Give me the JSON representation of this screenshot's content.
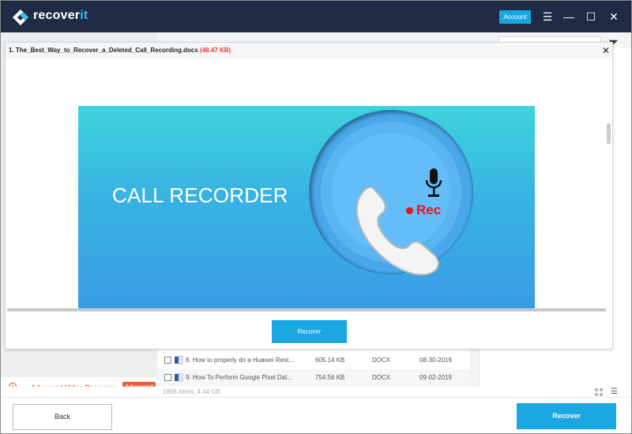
{
  "app": {
    "brand_prefix": "recover",
    "brand_suffix": "it",
    "account_label": "Account",
    "window_controls": [
      "menu-icon",
      "minimize-icon",
      "maximize-icon",
      "close-icon"
    ]
  },
  "modal": {
    "title": "1. The_Best_Way_to_Recover_a_Deleted_Call_Recording.docx",
    "size": "(48.47 KB)",
    "close_glyph": "✕",
    "preview": {
      "banner_text": "CALL RECORDER",
      "rec_text": "Rec"
    },
    "recover_label": "Recover"
  },
  "file_list": {
    "rows": [
      {
        "name": "8. How to properly do a Huawei Rest...",
        "size": "605.14  KB",
        "type": "DOCX",
        "date": "08-30-2019"
      },
      {
        "name": "9. How To Perform Google Pixel Dat...",
        "size": "754.56  KB",
        "type": "DOCX",
        "date": "09-02-2019"
      }
    ],
    "summary": "1866 items, 4.44  GB"
  },
  "sidebar": {
    "advanced_video_label": "Advanced Video Recovery",
    "advanced_badge": "Advanced"
  },
  "footer": {
    "back_label": "Back",
    "recover_label": "Recover"
  },
  "colors": {
    "titlebar": "#1f2a44",
    "accent": "#1ba7e2",
    "danger": "#e23c3c",
    "badge": "#ef5a3c"
  }
}
